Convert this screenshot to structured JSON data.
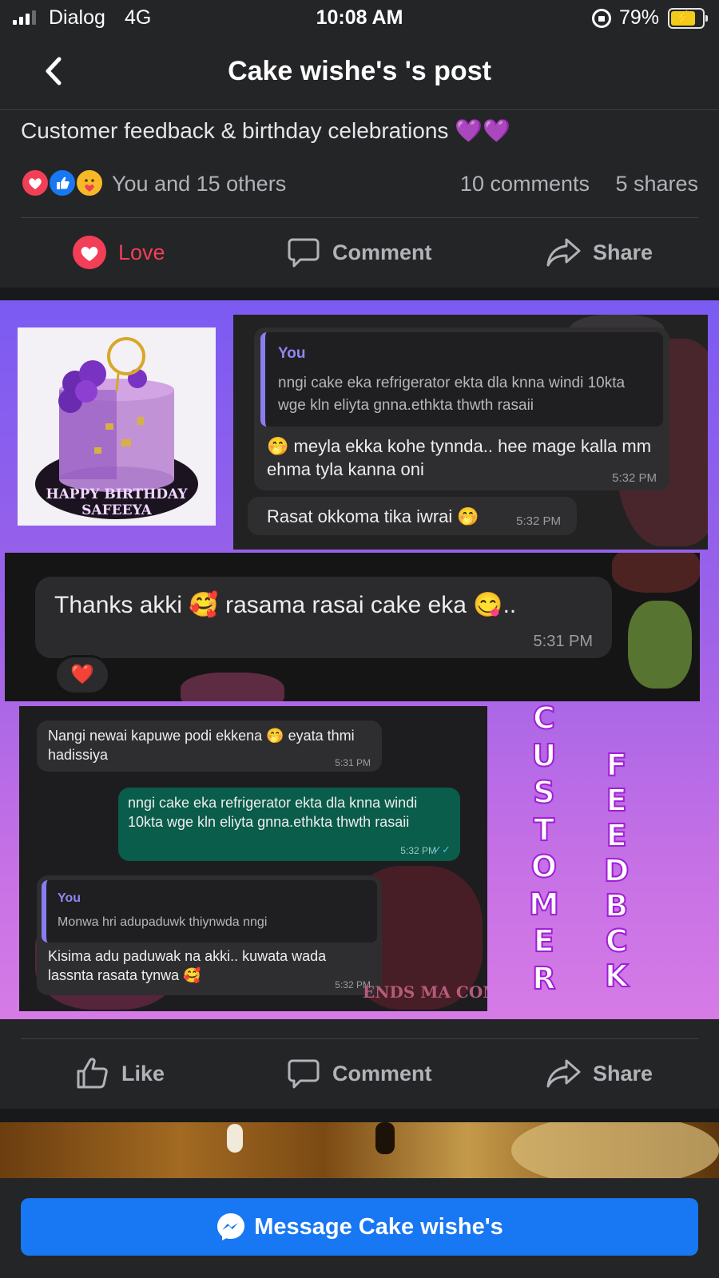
{
  "status_bar": {
    "carrier": "Dialog",
    "network": "4G",
    "time": "10:08 AM",
    "battery_percent": "79%",
    "battery_level": 0.79
  },
  "header": {
    "title": "Cake wishe's 's post",
    "back_icon": "chevron-left-icon"
  },
  "post": {
    "caption": "Customer feedback & birthday celebrations 💜💜",
    "reactions": {
      "icons": [
        "love-reaction-icon",
        "like-reaction-icon",
        "care-reaction-icon"
      ],
      "summary": "You and 15 others",
      "comments": "10 comments",
      "shares": "5 shares"
    },
    "actions": {
      "love": "Love",
      "comment": "Comment",
      "share": "Share"
    },
    "love_color": "#f33e58"
  },
  "image": {
    "cake_topper": "HAPPY BIRTHDAY",
    "cake_name": "SAFEEYA",
    "chat_a": {
      "quote_name": "You",
      "quote_text": "nngi cake eka refrigerator ekta dla knna windi 10kta wge kln eliyta gnna.ethkta thwth rasaii",
      "reply_text": "🤭 meyla ekka kohe tynnda.. hee mage kalla mm ehma tyla kanna oni",
      "reply_time": "5:32 PM",
      "msg2_text": "Rasat okkoma tika iwrai 🤭",
      "msg2_time": "5:32 PM"
    },
    "chat_b": {
      "text": "Thanks akki 🥰 rasama rasai cake eka 😋..",
      "time": "5:31 PM",
      "reaction": "❤️"
    },
    "chat_c": {
      "msg1_text": "Nangi newai kapuwe podi ekkena 🤭 eyata thmi hadissiya",
      "msg1_time": "5:31 PM",
      "msg2_text": "nngi cake eka refrigerator ekta dla knna windi 10kta wge kln eliyta gnna.ethkta thwth rasaii",
      "msg2_time": "5:32 PM",
      "quote_name": "You",
      "quote_text": "Monwa hri adupaduwk thiynwda nngi",
      "msg3_text": "Kisima adu paduwak na akki.. kuwata wada lassnta rasata tynwa 🥰",
      "msg3_time": "5:32 PM",
      "bg_text": "ENDS MA COME AND"
    },
    "vertical_word_1": [
      "C",
      "U",
      "S",
      "T",
      "O",
      "M",
      "E",
      "R"
    ],
    "vertical_word_2": [
      "F",
      "E",
      "E",
      "D",
      "B",
      "C",
      "K"
    ]
  },
  "post_actions": {
    "like": "Like",
    "comment": "Comment",
    "share": "Share"
  },
  "bottom": {
    "message_button": "Message Cake wishe's",
    "messenger_icon": "messenger-icon"
  }
}
